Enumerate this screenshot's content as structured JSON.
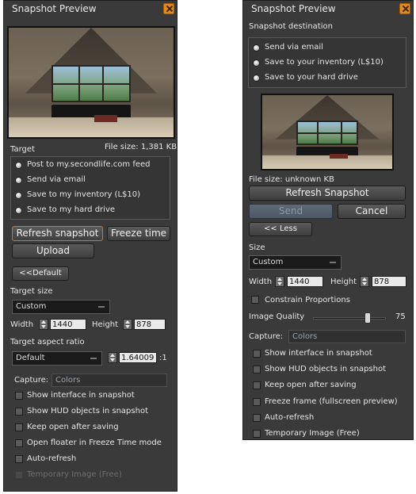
{
  "left": {
    "title": "Snapshot Preview",
    "target_label": "Target",
    "file_size": "File size: 1,381 KB",
    "target_options": [
      {
        "label": "Post to my.secondlife.com feed",
        "selected": false
      },
      {
        "label": "Send via email",
        "selected": false
      },
      {
        "label": "Save to my inventory (L$10)",
        "selected": false
      },
      {
        "label": "Save to my hard drive",
        "selected": false
      }
    ],
    "refresh_label": "Refresh snapshot",
    "freeze_label": "Freeze time",
    "upload_label": "Upload",
    "default_label": "<<Default",
    "target_size_label": "Target size",
    "target_size_value": "Custom",
    "width_label": "Width",
    "width_value": "1440",
    "height_label": "Height",
    "height_value": "878",
    "aspect_label": "Target aspect ratio",
    "aspect_value": "Default",
    "aspect_number": "1.64009",
    "aspect_suffix": ":1",
    "capture_label": "Capture:",
    "capture_value": "Colors",
    "checkboxes": [
      {
        "label": "Show interface in snapshot",
        "disabled": false
      },
      {
        "label": "Show HUD objects in snapshot",
        "disabled": false
      },
      {
        "label": "Keep open after saving",
        "disabled": false
      },
      {
        "label": "Open floater in Freeze Time mode",
        "disabled": false
      },
      {
        "label": "Auto-refresh",
        "disabled": false
      },
      {
        "label": "Temporary Image (Free)",
        "disabled": true
      }
    ]
  },
  "right": {
    "title": "Snapshot Preview",
    "destination_label": "Snapshot destination",
    "destination_options": [
      {
        "label": "Send via email",
        "selected": false
      },
      {
        "label": "Save to your inventory (L$10)",
        "selected": false
      },
      {
        "label": "Save to your hard drive",
        "selected": false
      }
    ],
    "file_size": "File size: unknown KB",
    "refresh_label": "Refresh Snapshot",
    "send_label": "Send",
    "cancel_label": "Cancel",
    "less_label": "<< Less",
    "size_label": "Size",
    "size_value": "Custom",
    "width_label": "Width",
    "width_value": "1440",
    "height_label": "Height",
    "height_value": "878",
    "constrain_label": "Constrain Proportions",
    "quality_label": "Image Quality",
    "quality_value": "75",
    "quality_fraction": 0.75,
    "capture_label": "Capture:",
    "capture_value": "Colors",
    "checkboxes": [
      {
        "label": "Show interface in snapshot"
      },
      {
        "label": "Show HUD objects in snapshot"
      },
      {
        "label": "Keep open after saving"
      },
      {
        "label": "Freeze frame (fullscreen preview)"
      },
      {
        "label": "Auto-refresh"
      },
      {
        "label": "Temporary Image (Free)"
      }
    ]
  },
  "colors": {
    "panel_bg": "#3a3a3a",
    "accent_orange": "#e58a1f"
  }
}
